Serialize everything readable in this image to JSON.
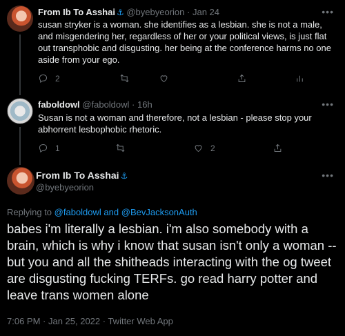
{
  "tweets": [
    {
      "name": "From Ib To Asshai",
      "handle": "@byebyeorion",
      "time": "Jan 24",
      "more": "•••",
      "text": "susan stryker is a woman. she identifies as a lesbian. she is not a male, and misgendering her, regardless of her or your political views, is just flat out transphobic and disgusting. her being at the conference harms no one aside from your ego.",
      "reply_count": "2",
      "retweet_count": "",
      "like_count": ""
    },
    {
      "name": "faboldowl",
      "handle": "@faboldowl",
      "time": "16h",
      "more": "•••",
      "text": "Susan is not a woman and therefore, not a lesbian - please stop your abhorrent lesbophobic rhetoric.",
      "reply_count": "1",
      "retweet_count": "",
      "like_count": "2"
    }
  ],
  "main": {
    "name": "From Ib To Asshai",
    "handle": "@byebyeorion",
    "more": "•••",
    "replying_prefix": "Replying to",
    "replying_user1": "@faboldowl",
    "replying_and": "and",
    "replying_user2": "@BevJacksonAuth",
    "text": "babes i'm literally a lesbian. i'm also somebody with a brain, which is why i know that susan isn't only a woman -- but you and all the shitheads interacting with the og tweet are disgusting fucking TERFs. go read harry potter and leave trans women alone",
    "timestamp": "7:06 PM · Jan 25, 2022 · Twitter Web App"
  },
  "colors": {
    "accent": "#1d9bf0",
    "background": "#000000",
    "text": "#e7e9ea",
    "muted": "#71767b"
  },
  "icons": [
    "reply-icon",
    "retweet-icon",
    "like-icon",
    "share-icon",
    "analytics-icon",
    "anchor-icon"
  ]
}
